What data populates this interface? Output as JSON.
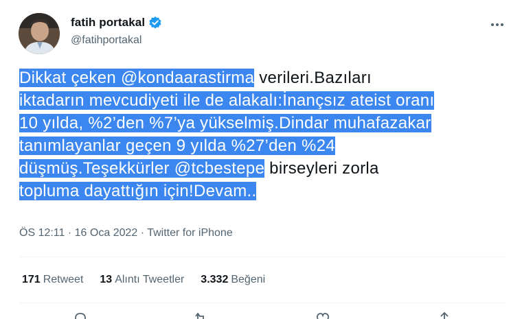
{
  "author": {
    "display_name": "fatih portakal",
    "handle": "@fatihportakal"
  },
  "tweet": {
    "lines": [
      {
        "hl": "Dikkat çeken @kondaarastirma",
        "plain": " verileri.Bazıları"
      },
      {
        "hl": "iktadarın mevcudiyeti ile de alakalı:İnançsız ateist oranı",
        "plain": ""
      },
      {
        "hl": "10 yılda, %2’den %7’ya yükselmiş.Dindar muhafazakar",
        "plain": ""
      },
      {
        "hl": "tanımlayanlar geçen 9 yılda %27’den %24",
        "plain": ""
      },
      {
        "hl": "düşmüş.Teşekkürler @tcbestepe",
        "plain": " birseyleri zorla"
      },
      {
        "hl": "topluma dayattığın için!Devam..",
        "plain": ""
      }
    ],
    "time": "ÖS 12:11",
    "date": "16 Oca 2022",
    "separator": "·",
    "source": "Twitter for iPhone"
  },
  "stats": {
    "retweets": {
      "count": "171",
      "label": "Retweet"
    },
    "quotes": {
      "count": "13",
      "label": "Alıntı Tweetler"
    },
    "likes": {
      "count": "3.332",
      "label": "Beğeni"
    }
  },
  "colors": {
    "selection_highlight": "#3b87ef",
    "verified_badge": "#1d9bf0",
    "secondary_text": "#536471"
  },
  "icons": [
    "verified-badge-icon",
    "more-options-icon",
    "reply-icon",
    "retweet-icon",
    "like-icon",
    "share-icon"
  ]
}
